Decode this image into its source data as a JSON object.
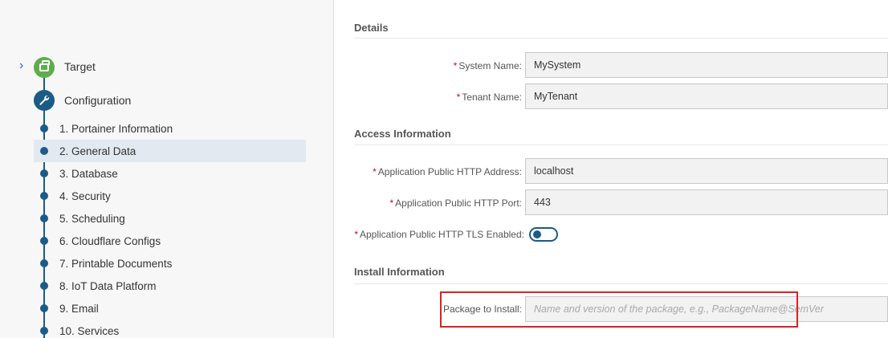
{
  "sidebar": {
    "target_label": "Target",
    "configuration_label": "Configuration",
    "steps": [
      {
        "label": "1. Portainer Information"
      },
      {
        "label": "2. General Data"
      },
      {
        "label": "3. Database"
      },
      {
        "label": "4. Security"
      },
      {
        "label": "5. Scheduling"
      },
      {
        "label": "6. Cloudflare Configs"
      },
      {
        "label": "7. Printable Documents"
      },
      {
        "label": "8. IoT Data Platform"
      },
      {
        "label": "9. Email"
      },
      {
        "label": "10. Services"
      }
    ],
    "active_step_index": 1
  },
  "details": {
    "title": "Details",
    "system_name": {
      "label": "System Name:",
      "value": "MySystem"
    },
    "tenant_name": {
      "label": "Tenant Name:",
      "value": "MyTenant"
    }
  },
  "access": {
    "title": "Access Information",
    "http_address": {
      "label": "Application Public HTTP Address:",
      "value": "localhost"
    },
    "http_port": {
      "label": "Application Public HTTP Port:",
      "value": "443"
    },
    "tls_enabled": {
      "label": "Application Public HTTP TLS Enabled:",
      "value": false
    }
  },
  "install": {
    "title": "Install Information",
    "package": {
      "label": "Package to Install:",
      "placeholder": "Name and version of the package, e.g., PackageName@SemVer"
    }
  },
  "required_marker": "*",
  "colors": {
    "accent": "#1b5b88",
    "target_green": "#5dae4a",
    "required_red": "#d0021b",
    "highlight_red": "#e02020"
  }
}
